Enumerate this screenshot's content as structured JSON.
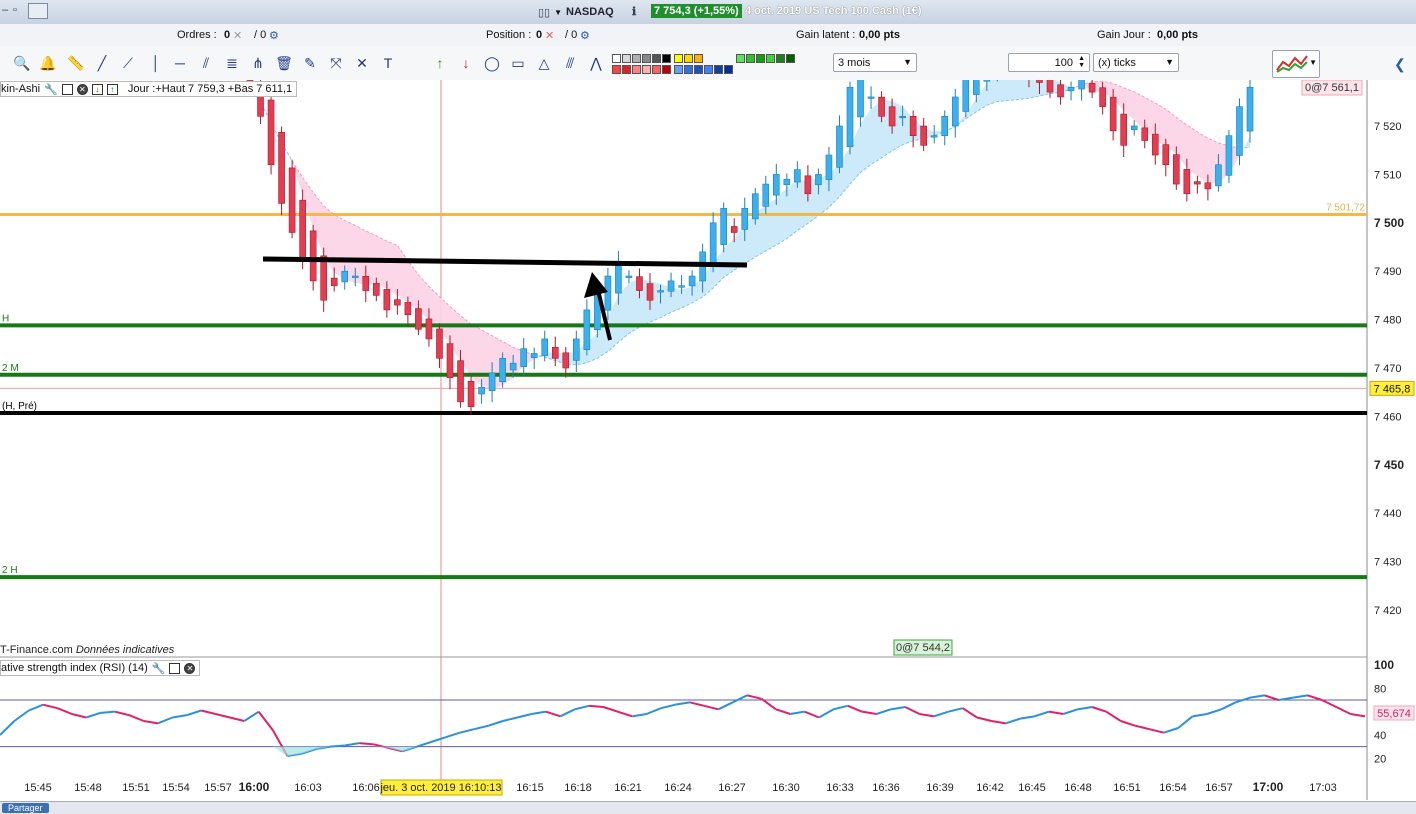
{
  "window": {
    "symbol": "NASDAQ",
    "price_badge": "7 754,3 (+1,55%)",
    "description": "4 oct. 2019 US Tech 100 Cash (1€)"
  },
  "infobar": {
    "orders_label": "Ordres :",
    "orders_value": "0",
    "orders_total": "/ 0",
    "position_label": "Position :",
    "position_value": "0",
    "position_total": "/ 0",
    "latent_label": "Gain latent :",
    "latent_value": "0,00 pts",
    "day_label": "Gain Jour :",
    "day_value": "0,00 pts"
  },
  "toolbar": {
    "period": "3 mois",
    "ticks_value": "100",
    "ticks_unit": "(x) ticks",
    "tools": [
      "zoom-icon",
      "alert-bell-icon",
      "ruler-icon",
      "line-icon",
      "ray-icon",
      "vertical-line-icon",
      "horizontal-line-icon",
      "fan-icon",
      "fibonacci-icon",
      "pitchfork-icon",
      "trash-icon",
      "properties-icon",
      "magnet-icon",
      "cross-icon",
      "text-icon",
      "buy-arrow-icon",
      "sell-arrow-icon",
      "ellipse-icon",
      "rectangle-icon",
      "triangle-icon",
      "channel-icon",
      "elliott-icon"
    ],
    "colors": {
      "icon": "#1a3a8a",
      "greys": [
        "#ffffff",
        "#d8d8d8",
        "#b0b0b0",
        "#888888",
        "#555555",
        "#000000"
      ],
      "reds": [
        "#ff4040",
        "#e02020",
        "#ff8080",
        "#ffb0b0",
        "#ff6060",
        "#c00000"
      ],
      "yellows": [
        "#ffff00",
        "#ffd800",
        "#ffb000"
      ],
      "blues": [
        "#60a0ff",
        "#3070e0",
        "#2050c0",
        "#4080ff",
        "#1040a0",
        "#0030a0"
      ],
      "greens": [
        "#60e060",
        "#30c030",
        "#10a010",
        "#40d040",
        "#208020",
        "#006000"
      ]
    }
  },
  "legend": {
    "main_name": "kin-Ashi",
    "main_info": "Jour :+Haut 7 759,3 +Bas 7 611,1",
    "rsi_name": "ative strength index (RSI) (14)"
  },
  "chart_data": {
    "type": "candlestick",
    "instrument": "NASDAQ",
    "price_axis": {
      "min": 7412,
      "max": 7528,
      "ticks": [
        "7 520",
        "7 510",
        "7 500",
        "7 490",
        "7 480",
        "7 470",
        "7 460",
        "7 450",
        "7 440",
        "7 430",
        "7 420"
      ],
      "bold_ticks": [
        "7 500",
        "7 450"
      ]
    },
    "time_axis": [
      "15:45",
      "15:48",
      "15:51",
      "15:54",
      "15:57",
      "16:00",
      "16:03",
      "16:06",
      "16:15",
      "16:18",
      "16:21",
      "16:24",
      "16:27",
      "16:30",
      "16:33",
      "16:36",
      "16:39",
      "16:42",
      "16:45",
      "16:48",
      "16:51",
      "16:54",
      "16:57",
      "17:00",
      "17:03"
    ],
    "bold_times": [
      "16:00",
      "17:00"
    ],
    "cursor_time_label": "jeu. 3 oct. 2019 16:10:13",
    "current_price_label": "7 465,8",
    "horizontal_levels": [
      {
        "price": 7501.72,
        "label": "7 501,72",
        "color": "#f7b740",
        "left_text": ""
      },
      {
        "price": 7478.8,
        "label": "",
        "color": "#157a15",
        "left_text": "H"
      },
      {
        "price": 7468.6,
        "label": "",
        "color": "#157a15",
        "left_text": "2 M"
      },
      {
        "price": 7460.7,
        "label": "",
        "color": "#000000",
        "left_text": "(H, Pré)"
      },
      {
        "price": 7426.8,
        "label": "",
        "color": "#157a15",
        "left_text": "2 H"
      }
    ],
    "drawn_line": {
      "from_time": "16:01",
      "to_time": "16:26",
      "price": 7491.5
    },
    "order_tags": [
      {
        "text": "0@7 561,1"
      },
      {
        "text": "0@7 544,2"
      }
    ],
    "watermark": "T-Finance.com",
    "watermark_note": "Données indicatives",
    "candles_close": [
      7528,
      7522,
      7512,
      7504,
      7498,
      7492,
      7488,
      7484,
      7487,
      7490,
      7489,
      7486,
      7485,
      7482,
      7483,
      7481,
      7478,
      7476,
      7472,
      7468,
      7463,
      7462,
      7466,
      7469,
      7472,
      7471,
      7474,
      7473,
      7476,
      7472,
      7470,
      7476,
      7482,
      7486,
      7489,
      7492,
      7489,
      7486,
      7484,
      7486,
      7488,
      7487,
      7489,
      7494,
      7500,
      7503,
      7498,
      7503,
      7506,
      7508,
      7510,
      7509,
      7511,
      7506,
      7510,
      7514,
      7520,
      7528,
      7530,
      7526,
      7522,
      7520,
      7522,
      7518,
      7516,
      7518,
      7522,
      7526,
      7530,
      7532,
      7534,
      7532,
      7531,
      7533,
      7530,
      7529,
      7527,
      7526,
      7528,
      7530,
      7527,
      7524,
      7519,
      7516,
      7520,
      7517,
      7514,
      7512,
      7508,
      7506,
      7508,
      7507,
      7512,
      7518,
      7524,
      7528
    ],
    "rsi": {
      "name": "RSI (14)",
      "axis_ticks": [
        "100",
        "80",
        "60",
        "40",
        "20"
      ],
      "value_label": "55,674",
      "levels": [
        70,
        30
      ],
      "values": [
        40,
        52,
        61,
        66,
        63,
        58,
        55,
        59,
        60,
        57,
        52,
        50,
        55,
        57,
        61,
        58,
        55,
        52,
        60,
        44,
        22,
        24,
        28,
        30,
        31,
        33,
        32,
        29,
        26,
        30,
        34,
        38,
        42,
        45,
        48,
        52,
        55,
        58,
        60,
        56,
        62,
        65,
        64,
        60,
        56,
        58,
        63,
        66,
        68,
        65,
        62,
        68,
        74,
        71,
        62,
        58,
        60,
        55,
        62,
        65,
        60,
        58,
        62,
        64,
        58,
        56,
        60,
        63,
        55,
        52,
        50,
        54,
        56,
        60,
        58,
        62,
        64,
        60,
        52,
        48,
        45,
        42,
        46,
        56,
        58,
        62,
        68,
        72,
        74,
        70,
        72,
        74,
        70,
        64,
        58,
        56
      ]
    }
  },
  "footer": {
    "share": "Partager"
  }
}
